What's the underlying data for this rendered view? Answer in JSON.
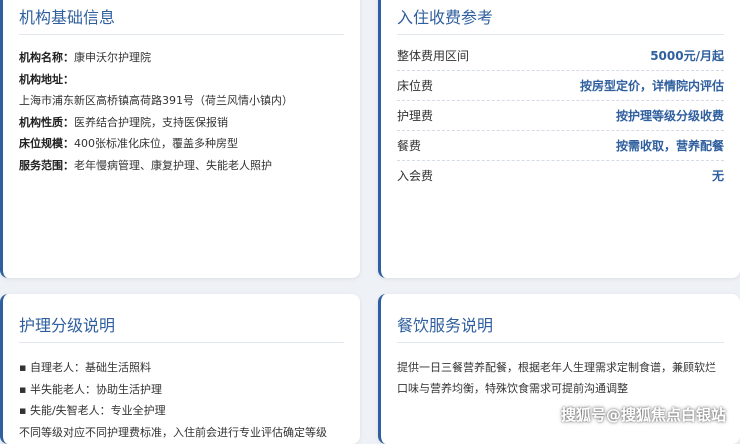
{
  "institution": {
    "title": "机构基础信息",
    "rows": [
      {
        "label": "机构名称：",
        "value": "康申沃尔护理院"
      },
      {
        "label": "机构地址：",
        "value": "上海市浦东新区高桥镇高荷路391号（荷兰风情小镇内）"
      },
      {
        "label": "机构性质：",
        "value": "医养结合护理院，支持医保报销"
      },
      {
        "label": "床位规模：",
        "value": "400张标准化床位，覆盖多种房型"
      },
      {
        "label": "服务范围：",
        "value": "老年慢病管理、康复护理、失能老人照护"
      }
    ]
  },
  "fees": {
    "title": "入住收费参考",
    "rows": [
      {
        "label": "整体费用区间",
        "value": "5000元/月起"
      },
      {
        "label": "床位费",
        "value": "按房型定价，详情院内评估"
      },
      {
        "label": "护理费",
        "value": "按护理等级分级收费"
      },
      {
        "label": "餐费",
        "value": "按需收取，营养配餐"
      },
      {
        "label": "入会费",
        "value": "无"
      }
    ]
  },
  "care_levels": {
    "title": "护理分级说明",
    "items": [
      "▪ 自理老人：基础生活照料",
      "▪ 半失能老人：协助生活护理",
      "▪ 失能/失智老人：专业全护理",
      "不同等级对应不同护理费标准，入住前会进行专业评估确定等级"
    ]
  },
  "dining": {
    "title": "餐饮服务说明",
    "text": "提供一日三餐营养配餐，根据老年人生理需求定制食谱，兼顾软烂口味与营养均衡，特殊饮食需求可提前沟通调整"
  },
  "watermark": "搜狐号@搜狐焦点白银站",
  "colors": {
    "accent": "#2f5f9e",
    "background": "#eef1f6"
  }
}
